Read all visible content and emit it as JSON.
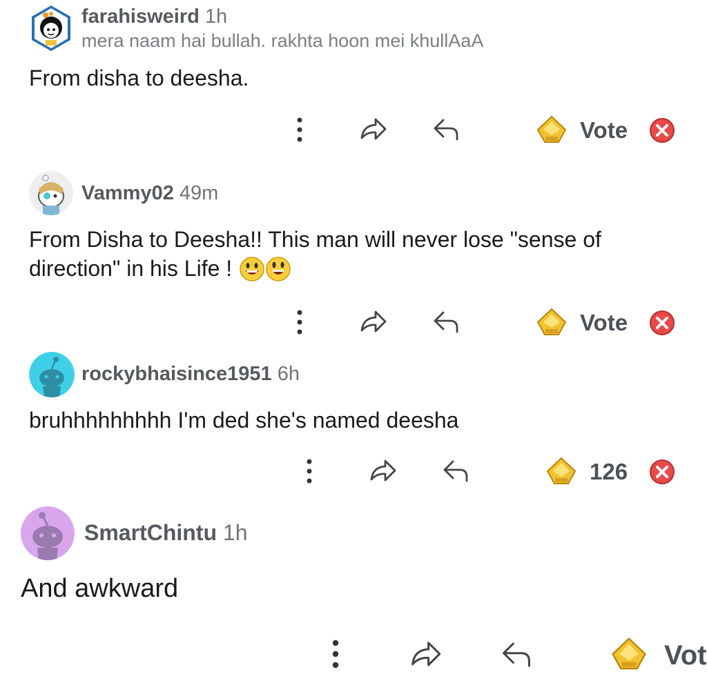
{
  "comments": [
    {
      "username": "farahisweird",
      "time": "1h",
      "flair": "mera naam hai bullah. rakhta hoon mei khullAaA",
      "text": "From disha to deesha.",
      "vote": "Vote"
    },
    {
      "username": "Vammy02",
      "time": "49m",
      "text": "From Disha to Deesha!! This man will never lose \"sense of direction\" in his Life !",
      "vote": "Vote"
    },
    {
      "username": "rockybhaisince1951",
      "time": "6h",
      "text": "bruhhhhhhhhh I'm ded she's named deesha",
      "vote": "126"
    },
    {
      "username": "SmartChintu",
      "time": "1h",
      "text": "And awkward",
      "vote": "Vot"
    }
  ],
  "colors": {
    "award_gold": "#f2c230",
    "hide_red": "#e84a4a",
    "avatar_cyan": "#3fd0e8",
    "avatar_purple": "#d9a6ee"
  },
  "icons": [
    "more-vertical-icon",
    "share-icon",
    "reply-icon",
    "award-icon",
    "close-circle-icon"
  ]
}
